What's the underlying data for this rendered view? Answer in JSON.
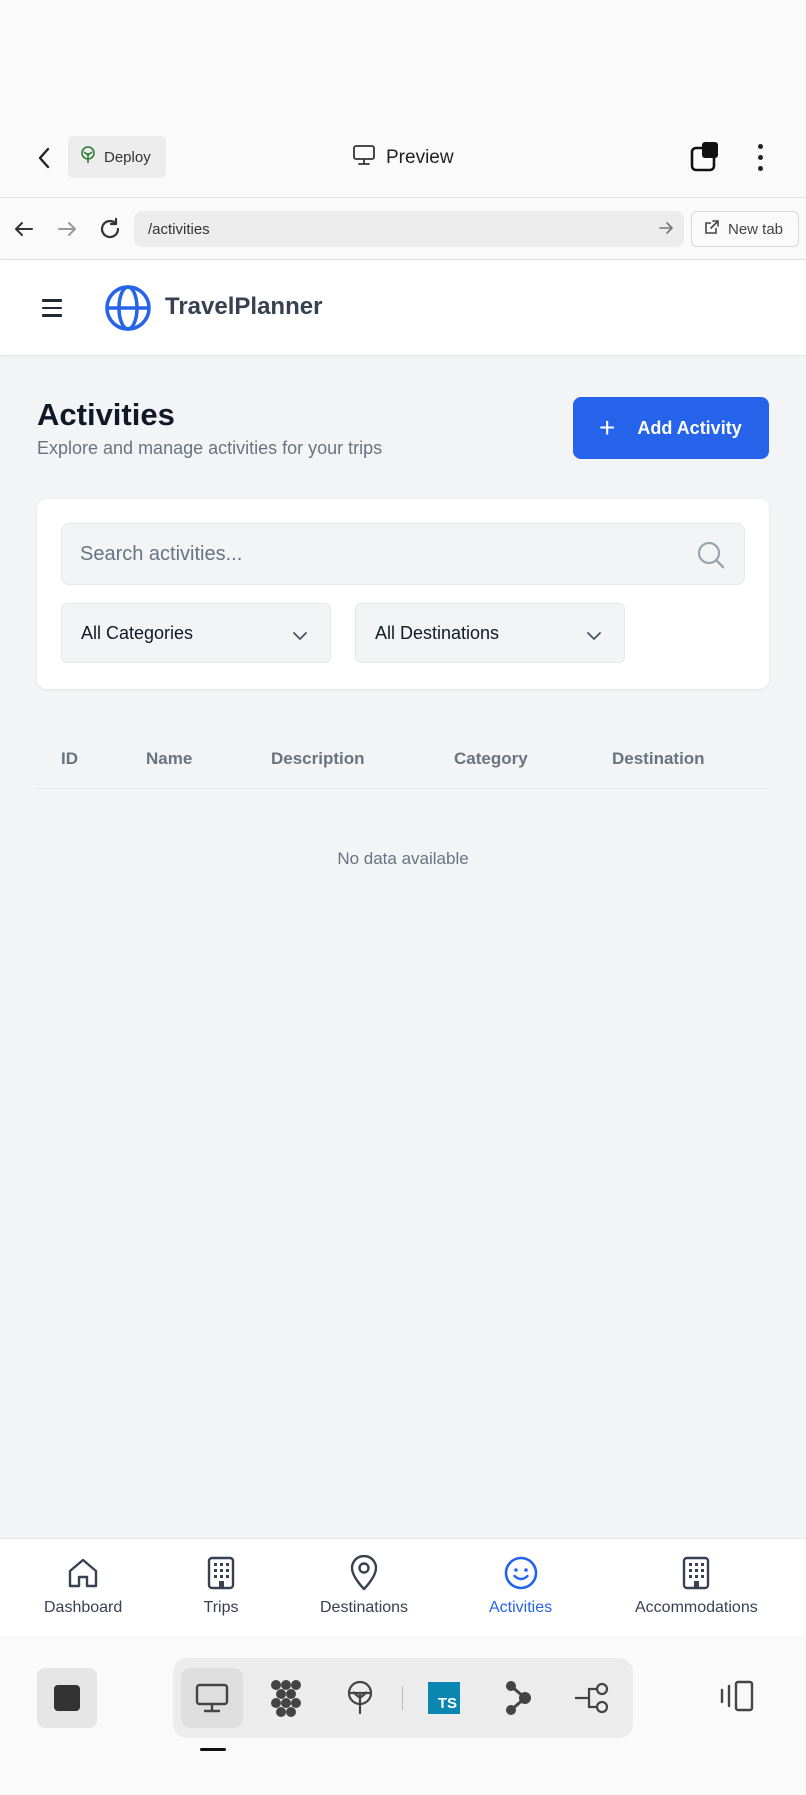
{
  "topbar": {
    "deploy_label": "Deploy",
    "preview_label": "Preview"
  },
  "addressbar": {
    "url": "/activities",
    "new_tab_label": "New tab"
  },
  "app": {
    "brand": "TravelPlanner"
  },
  "page": {
    "title": "Activities",
    "subtitle": "Explore and manage activities for your trips",
    "add_button": "Add Activity"
  },
  "filters": {
    "search_placeholder": "Search activities...",
    "category_select": "All Categories",
    "destination_select": "All Destinations"
  },
  "table": {
    "columns": [
      "ID",
      "Name",
      "Description",
      "Category",
      "Destination"
    ],
    "empty_message": "No data available"
  },
  "bottom_nav": {
    "items": [
      {
        "label": "Dashboard",
        "icon": "home-icon"
      },
      {
        "label": "Trips",
        "icon": "building-icon"
      },
      {
        "label": "Destinations",
        "icon": "map-pin-icon"
      },
      {
        "label": "Activities",
        "icon": "smile-icon",
        "active": true
      },
      {
        "label": "Accommodations",
        "icon": "hotel-icon"
      }
    ]
  },
  "dock": {
    "ts_badge": "TS"
  },
  "colors": {
    "accent": "#2563eb",
    "background": "#f3f4f6",
    "ts_badge": "#0b86b0"
  }
}
